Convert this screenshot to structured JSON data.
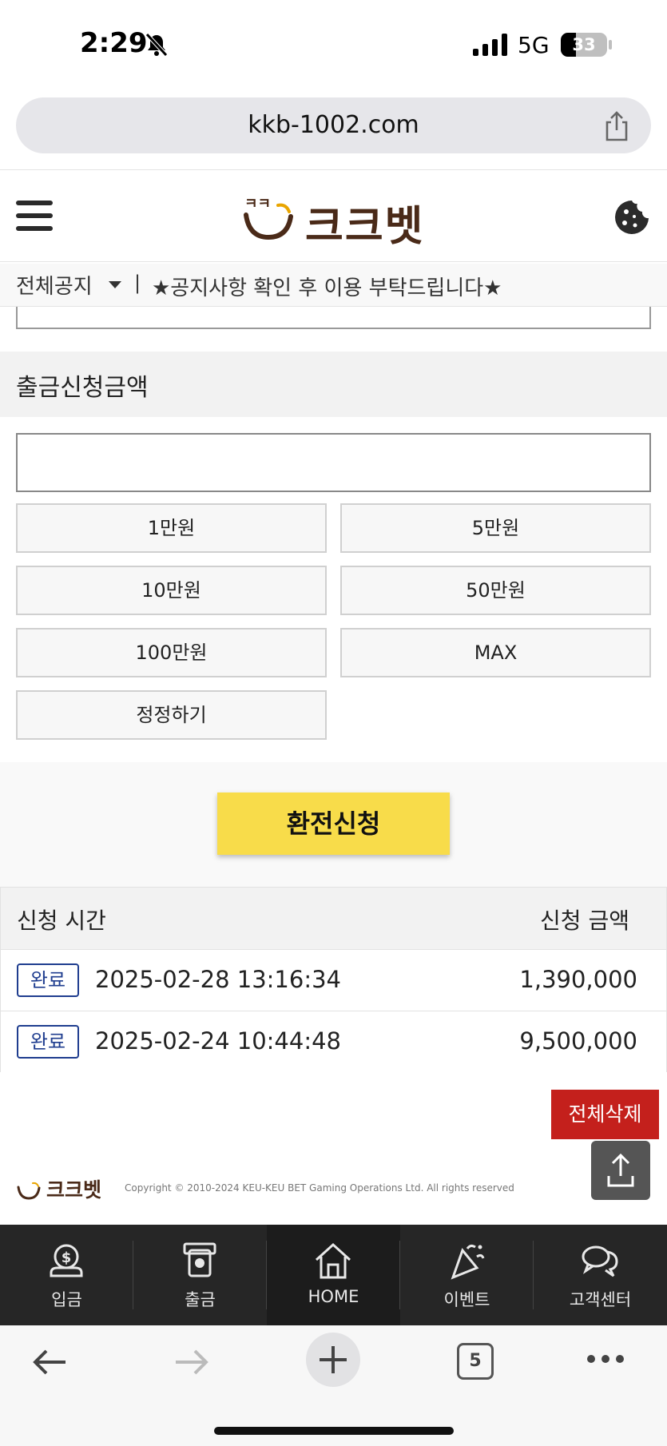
{
  "status_bar": {
    "time": "2:29",
    "network": "5G",
    "battery_level": "33",
    "battery_fraction": 0.33
  },
  "browser": {
    "url": "kkb-1002.com",
    "tab_count": "5"
  },
  "site": {
    "logo_text": "크크벳",
    "notice_category": "전체공지",
    "notice_separator": "|",
    "notice_text": "★공지사항 확인 후 이용  부탁드립니다★"
  },
  "withdraw": {
    "section_title": "출금신청금액",
    "amount_value": "",
    "chips": [
      "1만원",
      "5만원",
      "10만원",
      "50만원",
      "100만원",
      "MAX",
      "정정하기"
    ],
    "submit_label": "환전신청"
  },
  "history": {
    "col_time": "신청 시간",
    "col_amount": "신청 금액",
    "rows": [
      {
        "status": "완료",
        "time": "2025-02-28 13:16:34",
        "amount": "1,390,000"
      },
      {
        "status": "완료",
        "time": "2025-02-24 10:44:48",
        "amount": "9,500,000"
      }
    ],
    "delete_all_label": "전체삭제"
  },
  "footer": {
    "logo_text": "크크벳",
    "copyright": "Copyright © 2010-2024 KEU-KEU BET Gaming Operations Ltd. All rights reserved"
  },
  "bottom_nav": [
    {
      "label": "입금",
      "icon": "deposit-icon"
    },
    {
      "label": "출금",
      "icon": "withdraw-icon"
    },
    {
      "label": "HOME",
      "icon": "home-icon"
    },
    {
      "label": "이벤트",
      "icon": "party-icon"
    },
    {
      "label": "고객센터",
      "icon": "chat-icon"
    }
  ],
  "colors": {
    "submit": "#f8dc4a",
    "delete": "#c4201c",
    "badge": "#1f3d8f",
    "nav_bg": "#262626",
    "logo": "#4a2a18"
  }
}
